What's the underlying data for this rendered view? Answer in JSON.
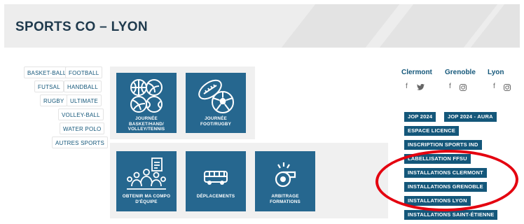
{
  "page": {
    "title": "SPORTS CO – LYON"
  },
  "sports": [
    "BASKET-BALL",
    "FOOTBALL",
    "FUTSAL",
    "HANDBALL",
    "RUGBY",
    "ULTIMATE",
    "VOLLEY-BALL",
    "WATER POLO",
    "AUTRES SPORTS"
  ],
  "tiles": [
    {
      "caption": "JOURNÉE\nBASKET/HAND/\nVOLLEY/TENNIS",
      "icon": "balls-icon"
    },
    {
      "caption": "JOURNÉE\nFOOT/RUGBY",
      "icon": "rugby-football-icon"
    },
    {
      "caption": "OBTENIR MA COMPO\nD'ÉQUIPE",
      "icon": "team-icon"
    },
    {
      "caption": "DÉPLACEMENTS",
      "icon": "bus-icon"
    },
    {
      "caption": "ARBITRAGE\nFORMATIONS",
      "icon": "whistle-icon"
    }
  ],
  "cities": [
    {
      "name": "Clermont",
      "icons": [
        "f",
        "twitter-icon"
      ]
    },
    {
      "name": "Grenoble",
      "icons": [
        "f",
        "instagram-icon"
      ]
    },
    {
      "name": "Lyon",
      "icons": [
        "f",
        "instagram-icon"
      ]
    }
  ],
  "links": [
    "JOP 2024",
    "JOP 2024 - AURA",
    "ESPACE LICENCE",
    "INSCRIPTION SPORTS IND",
    "LABELLISATION FFSU",
    "INSTALLATIONS CLERMONT",
    "INSTALLATIONS GRENOBLE",
    "INSTALLATIONS LYON",
    "INSTALLATIONS SAINT-ÉTIENNE"
  ],
  "colors": {
    "tile": "#26678f",
    "tag": "#14577a",
    "highlight": "#e4000f"
  }
}
